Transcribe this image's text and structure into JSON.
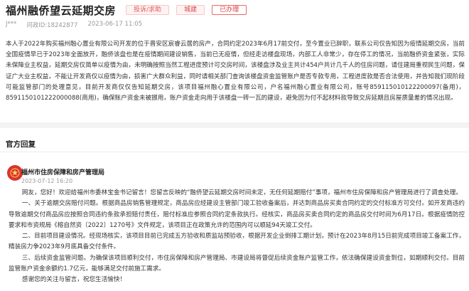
{
  "header": {
    "title": "福州融侨望云延期交房",
    "tags": {
      "type": "投诉/求助",
      "topic": "城建",
      "status": "已办理"
    }
  },
  "meta": {
    "user": "J***",
    "question_id": "问政ID:18242877",
    "date": "2023-06-17 11:05"
  },
  "complaint": {
    "paragraphs": [
      "本人于2022年购买福州融心置业有限公司开发的位于晋安区宸睿云居的房产，合同约定2023年6月17前交付，至今置业已辞职，联系公司仅告知因为疫情延期交房，当前全国疫情早已于2023年全面放开，融侨该盘也是在疫情期间建设销售，当前已无疫情，但经走访楼盘现场，内部工人非常少，存在停工的情况，当前融侨资金紧张，实际未保障业主权益，延期交房仅简单以疫情为由，未明确按照当然工程进度预计可交房时间，该楼盘涉及业主共计454户共计几千人的住房问题，请住建局重视民生问题，保证广大业主权益，不能让开发商仅以疫情为由，损害广大群众利益，同时请相关部门查询该楼盘资金监管账户是否专款专用，工程进度款是否合法使用，并告知我们现阶段可能监管部门的处理意见，目前开发商仅仅告知延期交房，该项目福州融心置业有限公司，户名福州融心置业有限公司，账号859115010122200097(备用)，8591150101222000088(商用)，确保账户资金未被挪用，账户资金走向用于该楼盘一砖一瓦的建设，避免因为付不起材料款导致交房延期且房屋质量差的情况出现。"
    ]
  },
  "official": {
    "section_title": "官方回复",
    "department": "福州市住房保障和房产管理局",
    "time": "2023-07-12 16:20",
    "paragraphs": [
      "网友，您好！欢迎给福州市委林宝金书记留言！您留言反映的“融侨望云延期交房时间未定，无任何延期赔付”事项，福州市住房保障和房产管理局进行了调查处理。",
      "一、关于逾期交房赔付问题。根据商品房销售管理规定，商品房应经建设主管部门竣工验收备案后，并达到商品房买卖合同约定的交付标准方可交付。如开发商违约导致逾期交付商品房应按照合同违约条款承担赔付责任，赔付标准应参照合同约定条款执行。经核实，商品房买卖合同约定的商品房交付时间为6月17日。根据疫情防控要求和市资规局《榕自然资〔2022〕1270号》文件规定，该项目正在政策允许的范围内可以顺延94天竣工交付。",
      "二、目前项目建设情况。经现场核实，该项目目前已完成五方验收和质监站预验收，根据开发企业倒排工期计划，预计在2023年8月15日前完成项目竣工备案工作，精装房力争2023年9月底具备交付条件。",
      "三、后续资金监管问题。为确保该项目顺利交付，市住房保障和房产管理局、市建设局将督促后续资金账户监管工作，依法确保建设资金到位，如期顺利交付。目前监管账户资金余额约1.7亿元，能够满足交付前施工需求。",
      "感谢您的关注与留言，祝您生活愉快！"
    ]
  },
  "colors": {
    "accent": "#e03a3a",
    "tag_bg": "#fff2f2",
    "logo": "#d9342b"
  },
  "icons": {
    "department_logo": "gov-emblem-icon"
  }
}
